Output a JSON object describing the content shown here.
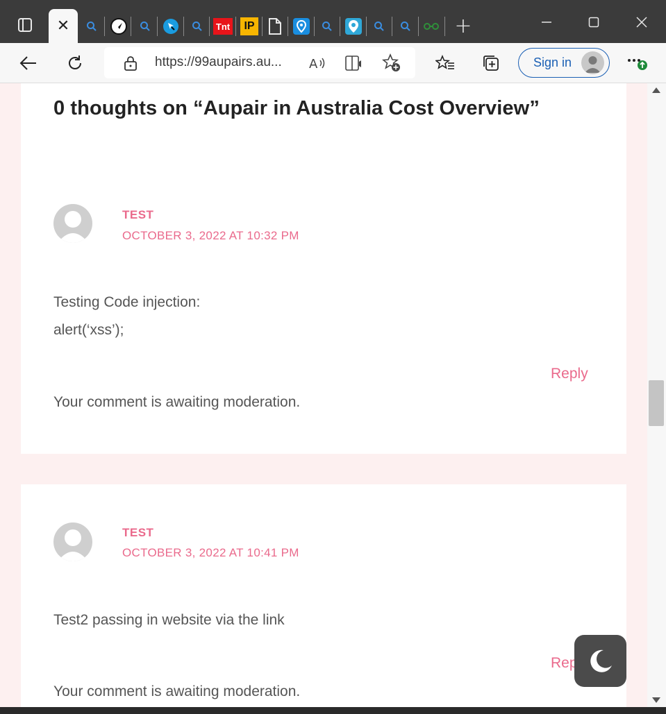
{
  "browser": {
    "url": "https://99aupairs.au...",
    "signin_label": "Sign in",
    "pinned_tabs": [
      "search-icon",
      "navigation-icon",
      "search-icon",
      "map-pin-icon",
      "search-icon",
      "tnt-icon",
      "ip-icon",
      "page-icon",
      "location-icon",
      "search-icon",
      "location-icon",
      "search-icon",
      "search-icon",
      "glasses-icon"
    ],
    "tnt_label": "Tnt",
    "ip_label": "IP"
  },
  "page": {
    "heading": "0 thoughts on “Aupair in Australia Cost Overview”",
    "comments": [
      {
        "author": "TEST",
        "date": "OCTOBER 3, 2022 AT 10:32 PM",
        "lines": [
          "Testing Code injection:",
          "alert(‘xss’);"
        ],
        "reply": "Reply",
        "awaiting": "Your comment is awaiting moderation."
      },
      {
        "author": "TEST",
        "date": "OCTOBER 3, 2022 AT 10:41 PM",
        "lines": [
          "Test2 passing in website via the link"
        ],
        "reply": "Reply",
        "awaiting": "Your comment is awaiting moderation."
      }
    ]
  },
  "colors": {
    "accent": "#ea6a8c",
    "page_bg": "#fdf0f0",
    "edge_blue": "#1a5fb4"
  }
}
